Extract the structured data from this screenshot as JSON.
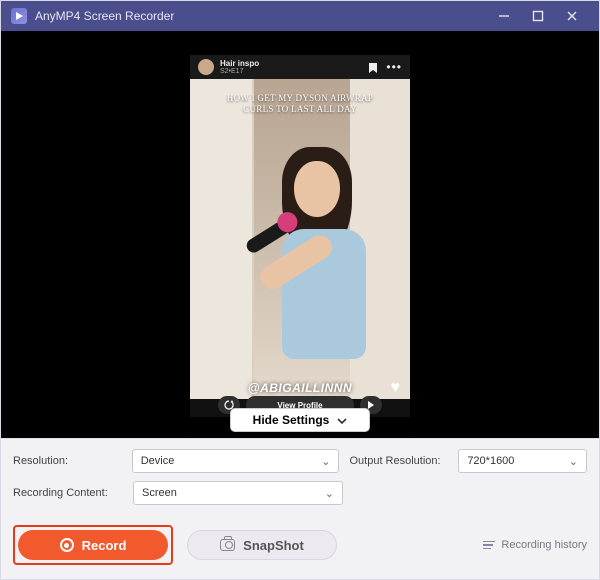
{
  "titlebar": {
    "title": "AnyMP4 Screen Recorder"
  },
  "preview": {
    "post": {
      "account_name": "Hair inspo",
      "account_meta": "S2•E17",
      "flag_icon_name": "bookmark-icon",
      "more_icon_name": "more-icon"
    },
    "overlay_caption": "HOW I GET MY DYSON AIRWRAP CURLS TO LAST ALL DAY",
    "handle": "@ABIGAILLINNN",
    "view_profile_label": "View Profile",
    "hide_settings_label": "Hide Settings"
  },
  "settings": {
    "resolution_label": "Resolution:",
    "resolution_value": "Device",
    "output_label": "Output Resolution:",
    "output_value": "720*1600",
    "content_label": "Recording Content:",
    "content_value": "Screen"
  },
  "actions": {
    "record_label": "Record",
    "snapshot_label": "SnapShot",
    "history_label": "Recording history"
  },
  "colors": {
    "titlebar_bg": "#4a4e8c",
    "record_bg": "#f25a2e",
    "highlight_border": "#e63b18"
  }
}
